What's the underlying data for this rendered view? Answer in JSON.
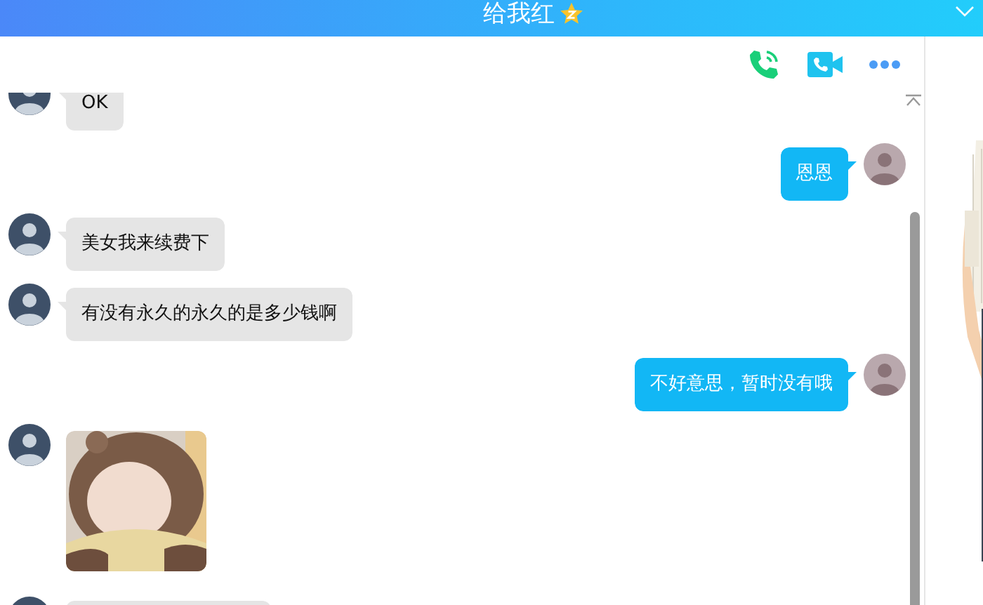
{
  "window": {
    "title": "给我红"
  },
  "messages": [
    {
      "outgoing": false,
      "kind": "text",
      "text": "OK"
    },
    {
      "outgoing": true,
      "kind": "text",
      "text": "恩恩"
    },
    {
      "outgoing": false,
      "kind": "text",
      "text": "美女我来续费下"
    },
    {
      "outgoing": false,
      "kind": "text",
      "text": "有没有永久的永久的是多少钱啊"
    },
    {
      "outgoing": true,
      "kind": "text",
      "text": "不好意思，暂时没有哦"
    },
    {
      "outgoing": false,
      "kind": "sticker"
    },
    {
      "outgoing": false,
      "kind": "text"
    }
  ]
}
